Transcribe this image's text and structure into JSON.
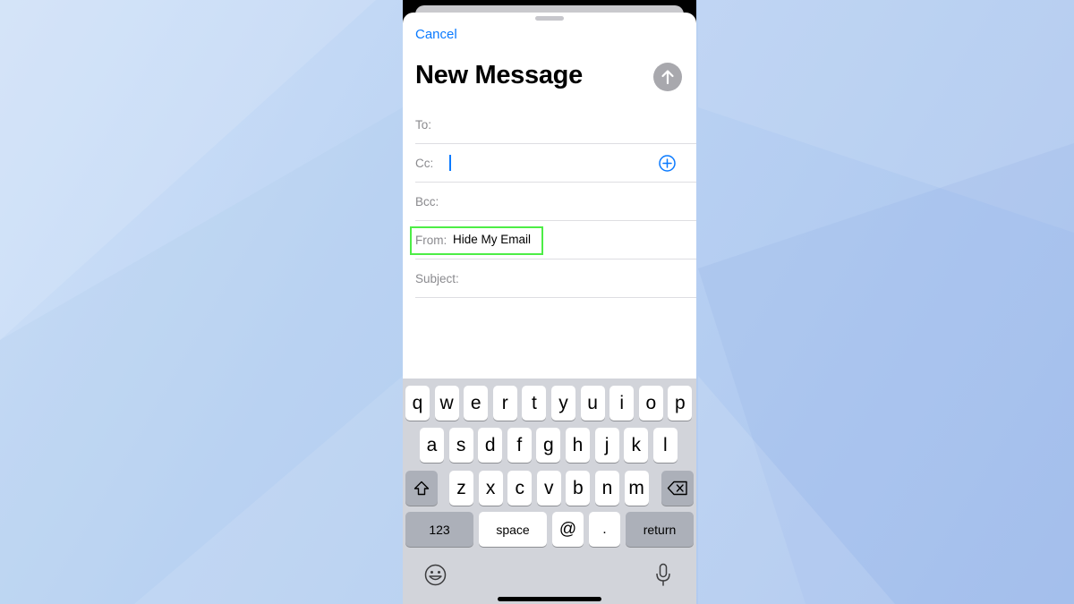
{
  "compose": {
    "cancel_label": "Cancel",
    "title": "New Message",
    "fields": {
      "to_label": "To:",
      "cc_label": "Cc:",
      "bcc_label": "Bcc:",
      "from_label": "From:",
      "from_value": "Hide My Email",
      "subject_label": "Subject:"
    }
  },
  "keyboard": {
    "row1": [
      "q",
      "w",
      "e",
      "r",
      "t",
      "y",
      "u",
      "i",
      "o",
      "p"
    ],
    "row2": [
      "a",
      "s",
      "d",
      "f",
      "g",
      "h",
      "j",
      "k",
      "l"
    ],
    "row3": [
      "z",
      "x",
      "c",
      "v",
      "b",
      "n",
      "m"
    ],
    "numbers_label": "123",
    "space_label": "space",
    "at_label": "@",
    "period_label": ".",
    "return_label": "return",
    "icons": [
      "shift-icon",
      "backspace-icon",
      "emoji-icon",
      "microphone-icon"
    ]
  },
  "colors": {
    "accent": "#0a7aff",
    "highlight": "#4ded46",
    "keyboard_bg": "#d2d4da"
  }
}
